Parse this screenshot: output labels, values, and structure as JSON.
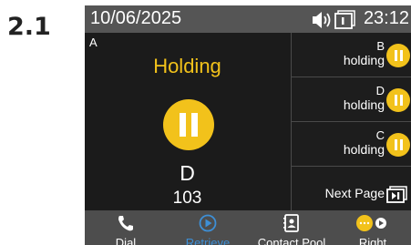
{
  "step_number": "2.1",
  "status_bar": {
    "date": "10/06/2025",
    "time": "23:12"
  },
  "active_call": {
    "line": "A",
    "status": "Holding",
    "contact_name": "D",
    "contact_number": "103"
  },
  "call_list": [
    {
      "line": "B",
      "state": "holding"
    },
    {
      "line": "D",
      "state": "holding"
    },
    {
      "line": "C",
      "state": "holding"
    }
  ],
  "next_page_label": "Next Page",
  "softkeys": [
    {
      "label": "Dial",
      "icon": "phone-icon"
    },
    {
      "label": "Retrieve",
      "icon": "play-circle-icon",
      "active": true
    },
    {
      "label": "Contact Pool",
      "icon": "contacts-icon"
    },
    {
      "label": "Right",
      "icon": "more-right-icon"
    }
  ],
  "colors": {
    "hold_yellow": "#f2c21b",
    "active_blue": "#3d8fd6",
    "screen_bg": "#1a1a1a",
    "status_bar_bg": "#555555"
  }
}
